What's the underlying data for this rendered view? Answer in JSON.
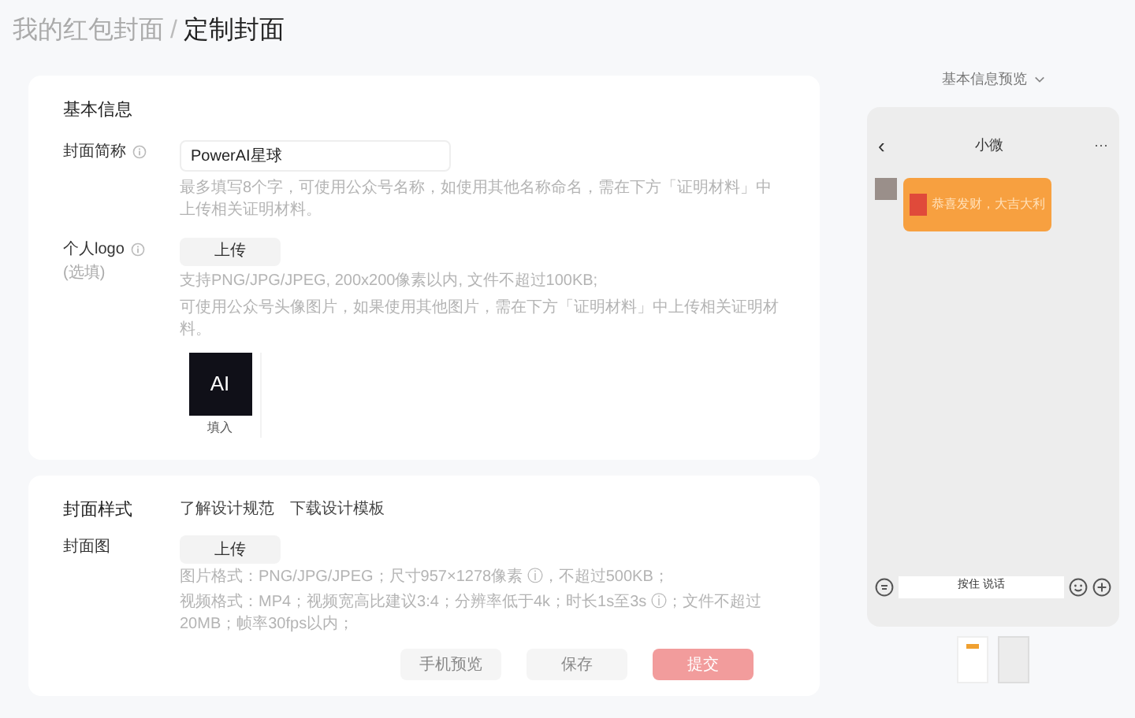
{
  "breadcrumb": {
    "parent": "我的红包封面",
    "separator": "/",
    "current": "定制封面"
  },
  "basic_info": {
    "title": "基本信息",
    "name_field": {
      "label": "封面简称",
      "value": "PowerAI星球",
      "hint": "最多填写8个字，可使用公众号名称，如使用其他名称命名，需在下方「证明材料」中上传相关证明材料。"
    },
    "logo_field": {
      "label": "个人logo",
      "optional": "(选填)",
      "upload": "上传",
      "hints": [
        "支持PNG/JPG/JPEG, 200x200像素以内, 文件不超过100KB;",
        "可使用公众号头像图片，如果使用其他图片，需在下方「证明材料」中上传相关证明材料。"
      ],
      "logo_text": "AI",
      "logo_caption": "填入"
    }
  },
  "cover_style": {
    "title": "封面样式",
    "links": [
      "了解设计规范",
      "下载设计模板"
    ],
    "cover_field": {
      "label": "封面图",
      "upload": "上传",
      "hints": [
        "图片格式：PNG/JPG/JPEG；尺寸957×1278像素 ⓘ，不超过500KB；",
        "视频格式：MP4；视频宽高比建议3:4；分辨率低于4k；时长1s至3s ⓘ；文件不超过20MB；帧率30fps以内；"
      ]
    }
  },
  "actions": [
    {
      "label": "手机预览",
      "kind": "secondary"
    },
    {
      "label": "保存",
      "kind": "secondary"
    },
    {
      "label": "提交",
      "kind": "primary"
    }
  ],
  "preview": {
    "selector": "基本信息预览",
    "chat_title": "小微",
    "back": "‹",
    "more": "···",
    "envelope_text": "恭喜发财，大吉大利",
    "input_hint": "按住 说话"
  }
}
